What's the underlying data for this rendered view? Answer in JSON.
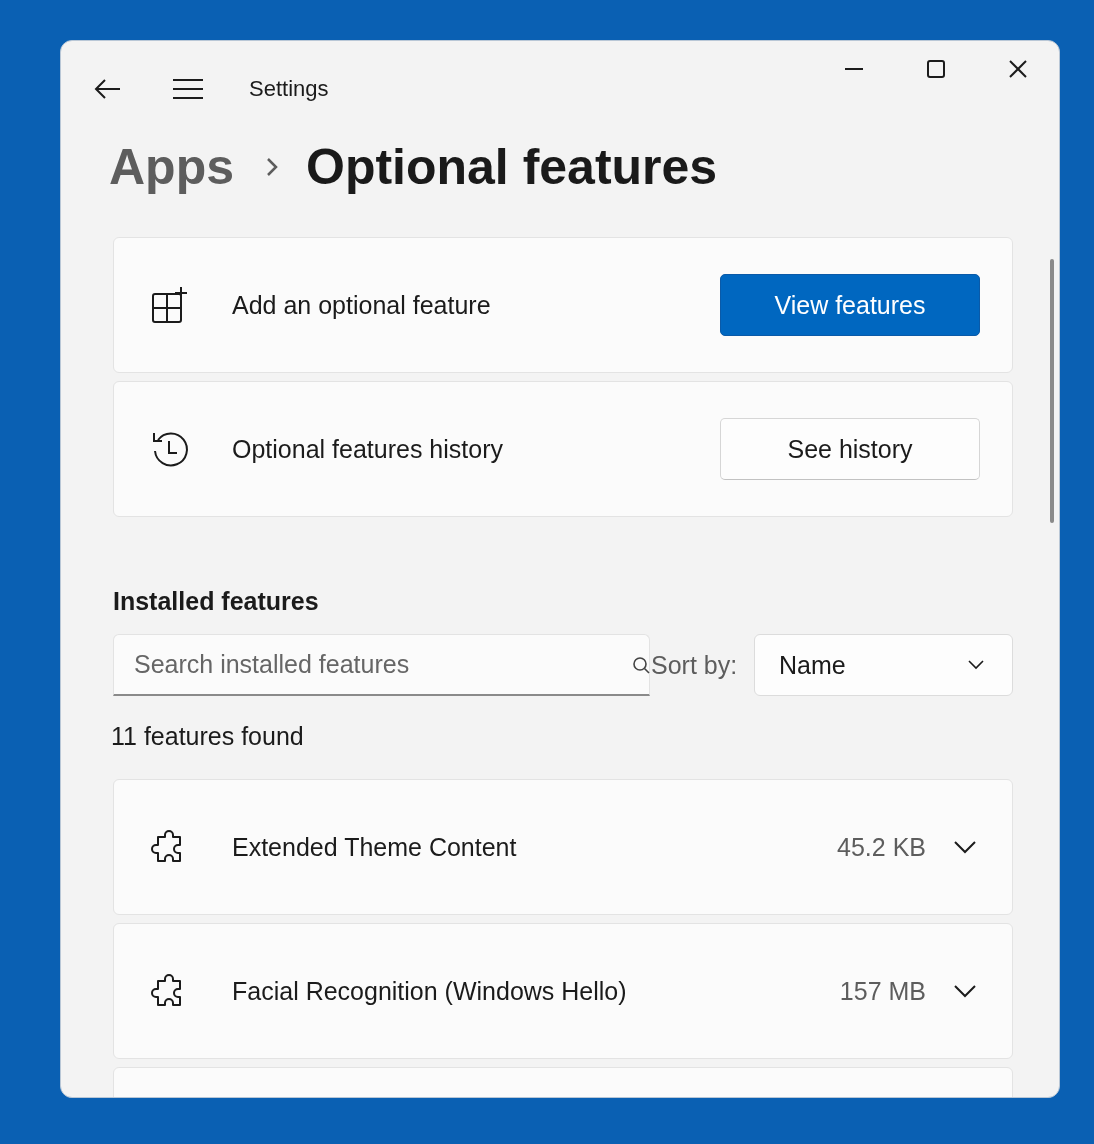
{
  "window": {
    "title": "Settings"
  },
  "breadcrumb": {
    "parent": "Apps",
    "current": "Optional features"
  },
  "actions": [
    {
      "kind": "add",
      "label": "Add an optional feature",
      "button": "View features"
    },
    {
      "kind": "history",
      "label": "Optional features history",
      "button": "See history"
    }
  ],
  "installed": {
    "heading": "Installed features",
    "search": {
      "placeholder": "Search installed features"
    },
    "sort_label": "Sort by:",
    "sort_value": "Name",
    "count": "11 features found",
    "features": [
      {
        "name": "Extended Theme Content",
        "size": "45.2 KB",
        "expanded": false
      },
      {
        "name": "Facial Recognition (Windows Hello)",
        "size": "157 MB",
        "expanded": false
      }
    ]
  }
}
